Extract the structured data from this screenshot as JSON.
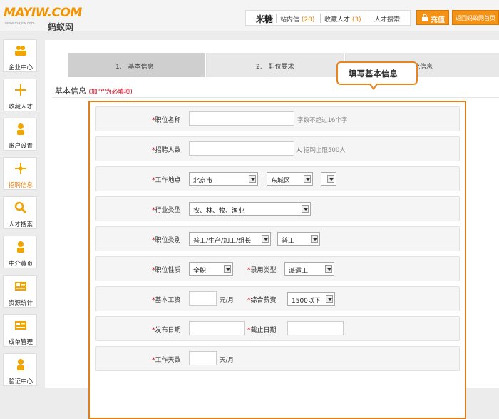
{
  "header": {
    "logo_text": "MAYIW.COM",
    "logo_sub": "蚂蚁网",
    "logo_url": "www.mayiw.com",
    "user_name": "米糖",
    "inbox_label": "站内信",
    "inbox_count": "(20)",
    "favorites_label": "收藏人才",
    "favorites_count": "(3)",
    "talent_search": "人才搜索",
    "recharge": "充值",
    "back_home": "返回蚂蚁网首页"
  },
  "sidebar": {
    "items": [
      {
        "label": "企业中心",
        "icon": "users-icon"
      },
      {
        "label": "收藏人才",
        "icon": "collect-icon"
      },
      {
        "label": "账户设置",
        "icon": "account-icon"
      },
      {
        "label": "招聘信息",
        "icon": "recruit-icon"
      },
      {
        "label": "人才搜索",
        "icon": "search-icon"
      },
      {
        "label": "中介黄页",
        "icon": "agency-icon"
      },
      {
        "label": "资源统计",
        "icon": "stats-icon"
      },
      {
        "label": "成单管理",
        "icon": "orders-icon"
      },
      {
        "label": "验证中心",
        "icon": "verify-icon"
      }
    ]
  },
  "steps": [
    {
      "label": "1.　基本信息"
    },
    {
      "label": "2.　职位要求"
    },
    {
      "label": "统信息"
    }
  ],
  "section": {
    "title": "基本信息",
    "note": "(加\"*\"为必填项)"
  },
  "callout": "填写基本信息",
  "form": {
    "job_name": {
      "label": "职位名称",
      "value": "",
      "hint": "字数不超过16个字"
    },
    "headcount": {
      "label": "招聘人数",
      "value": "",
      "unit": "人",
      "hint": "招聘上限500人"
    },
    "location": {
      "label": "工作地点",
      "city": "北京市",
      "district": "东城区",
      "extra": ""
    },
    "industry": {
      "label": "行业类型",
      "value": "农、林、牧、渔业"
    },
    "category": {
      "label": "职位类别",
      "main": "普工/生产/加工/组长",
      "sub": "普工"
    },
    "nature": {
      "label": "职位性质",
      "value": "全职"
    },
    "employ_type": {
      "label": "录用类型",
      "value": "派遣工"
    },
    "base_salary": {
      "label": "基本工资",
      "value": "",
      "unit": "元/月"
    },
    "total_salary": {
      "label": "综合薪资",
      "value": "1500以下"
    },
    "publish_date": {
      "label": "发布日期",
      "value": ""
    },
    "deadline": {
      "label": "截止日期",
      "value": ""
    },
    "work_days": {
      "label": "工作天数",
      "value": "",
      "unit": "天/月"
    },
    "required_mark": "*"
  },
  "colors": {
    "accent": "#f39214",
    "highlight_border": "#e07e1e",
    "required": "#d0021b"
  }
}
